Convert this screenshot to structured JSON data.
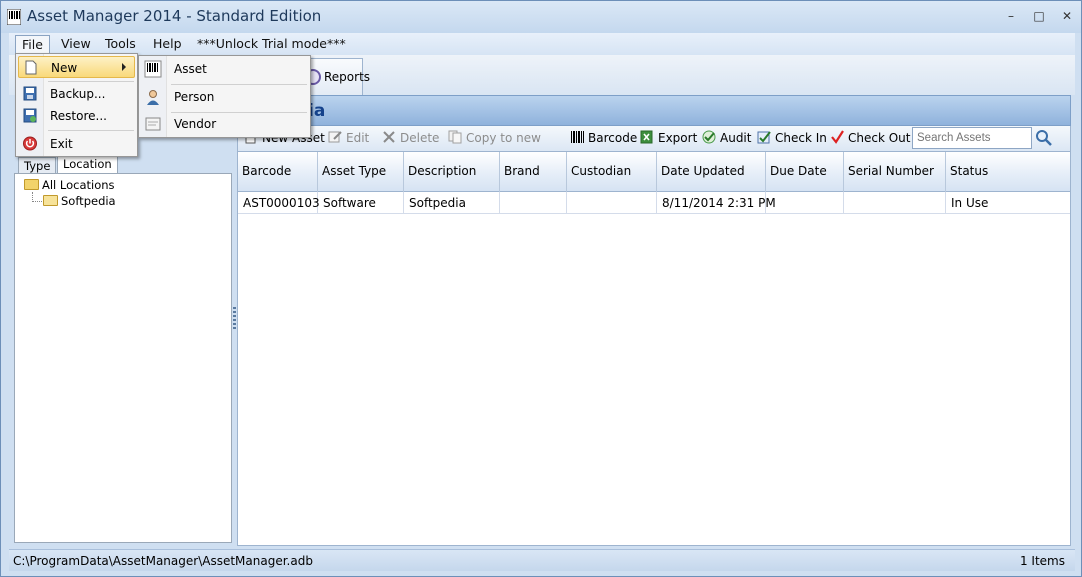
{
  "window": {
    "title": "Asset Manager 2014 - Standard Edition",
    "controls": {
      "minimize": "–",
      "maximize": "□",
      "close": "✕"
    }
  },
  "menubar": {
    "items": [
      {
        "label": "File"
      },
      {
        "label": "View"
      },
      {
        "label": "Tools"
      },
      {
        "label": "Help"
      },
      {
        "label": "***Unlock Trial mode***"
      }
    ]
  },
  "file_menu": {
    "items": [
      {
        "label": "New",
        "icon": "new-document-icon"
      },
      {
        "label": "Backup...",
        "icon": "save-icon"
      },
      {
        "label": "Restore...",
        "icon": "restore-icon"
      },
      {
        "label": "Exit",
        "icon": "power-icon"
      }
    ]
  },
  "new_submenu": {
    "items": [
      {
        "label": "Asset",
        "icon": "barcode-icon"
      },
      {
        "label": "Person",
        "icon": "person-icon"
      },
      {
        "label": "Vendor",
        "icon": "vendor-icon"
      }
    ]
  },
  "ribbon": {
    "reports_label": "Reports"
  },
  "left_panel": {
    "tabs": [
      {
        "label": "Type"
      },
      {
        "label": "Location"
      }
    ],
    "tree": {
      "root": "All Locations",
      "child": "Softpedia"
    }
  },
  "main": {
    "header_title": "Softpedia",
    "header_visible_suffix": "ia",
    "toolbar": {
      "new_asset": "New Asset",
      "edit": "Edit",
      "delete": "Delete",
      "copy_to_new": "Copy to new",
      "barcode": "Barcode",
      "export": "Export",
      "audit": "Audit",
      "check_in": "Check In",
      "check_out": "Check Out",
      "search_placeholder": "Search Assets"
    },
    "table": {
      "columns": [
        "Barcode",
        "Asset Type",
        "Description",
        "Brand",
        "Custodian",
        "Date Updated",
        "Due Date",
        "Serial Number",
        "Status"
      ],
      "rows": [
        [
          "AST0000103",
          "Software",
          "Softpedia",
          "",
          "",
          "8/11/2014 2:31 PM",
          "",
          "",
          "In Use"
        ]
      ]
    }
  },
  "statusbar": {
    "path": "C:\\ProgramData\\AssetManager\\AssetManager.adb",
    "count": "1 Items"
  },
  "colors": {
    "window_bg": "#cfdff1",
    "header_text": "#15428b",
    "menu_highlight": "#f9d97a"
  }
}
